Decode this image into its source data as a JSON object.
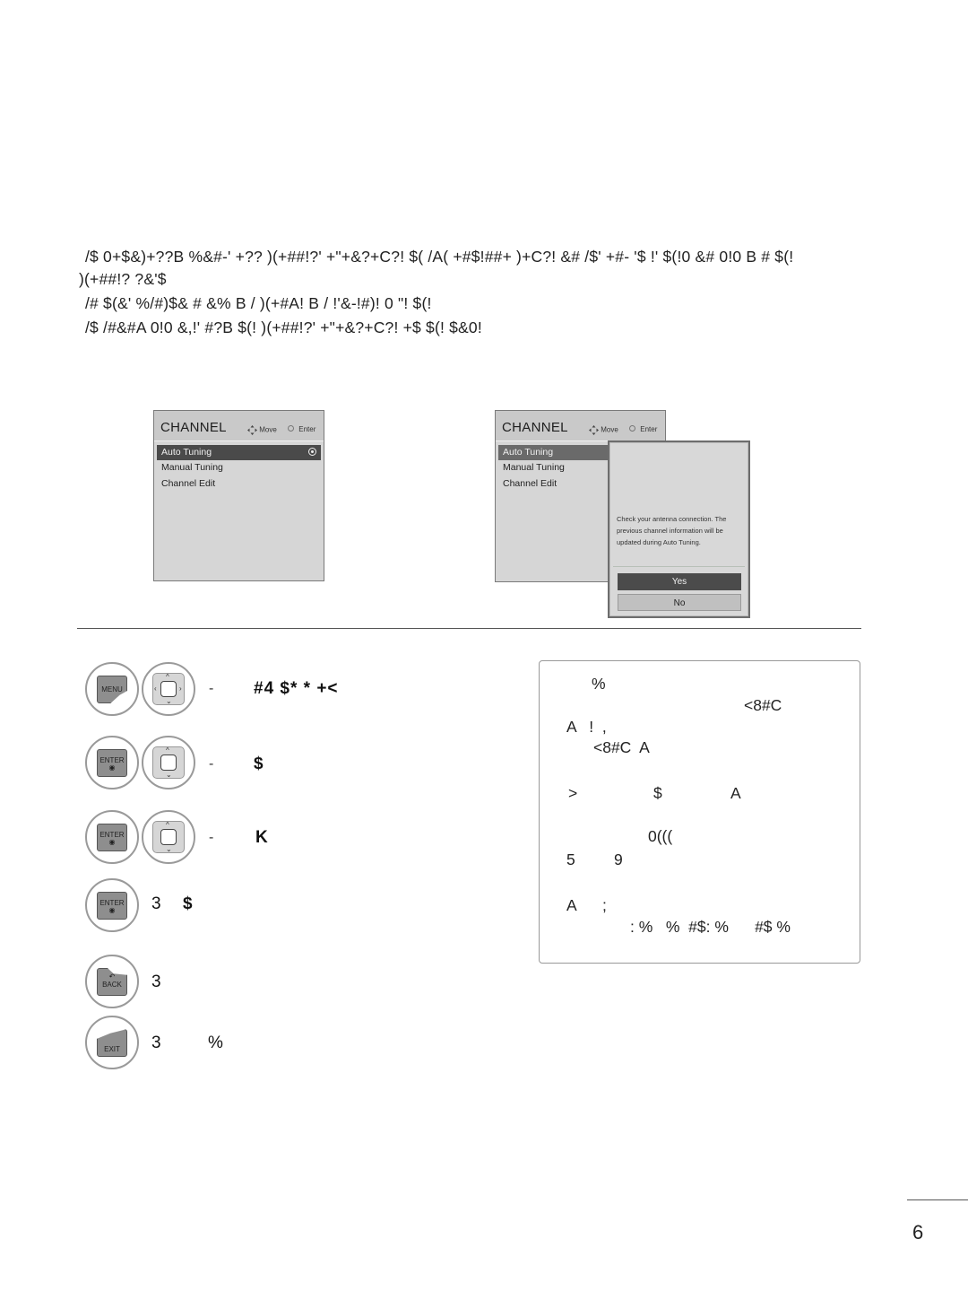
{
  "intro": {
    "lines": [
      "/$ 0+$&)+??B %&#-' +?? )(+##!?' +\"+&?+C?! $(  /A( +#$!##+     )+C?! &# /$'  +#- '$  !' $(!0 &# 0!0  B  # $(!",
      ")(+##!? ?&'$",
      "/# $(&' %/#)$& # &% B / )(+#A! B /   !'&-!#)!    0 \"! $(!",
      "/$   /#&#A 0!0  &,!'  #?B $(! )(+##!?' +\"+&?+C?! +$ $(! $&0!"
    ]
  },
  "osd_left": {
    "title": "CHANNEL",
    "hint_move": "Move",
    "hint_enter": "Enter",
    "items": [
      "Auto Tuning",
      "Manual Tuning",
      "Channel Edit"
    ],
    "selected_index": 0
  },
  "osd_right": {
    "title": "CHANNEL",
    "hint_move": "Move",
    "hint_enter": "Enter",
    "items": [
      "Auto Tuning",
      "Manual Tuning",
      "Channel Edit"
    ],
    "popup": {
      "message": "Check your antenna connection. The previous channel information will be updated during Auto Tuning.",
      "yes_label": "Yes",
      "no_label": "No"
    }
  },
  "steps": [
    {
      "keys": [
        "MENU",
        "nav-4way"
      ],
      "marker": "-",
      "text": "#4 $* * +<"
    },
    {
      "keys": [
        "ENTER",
        "nav-updown"
      ],
      "marker": "-",
      "text": "$"
    },
    {
      "keys": [
        "ENTER",
        "nav-updown"
      ],
      "marker": "-",
      "text": "K"
    },
    {
      "keys": [
        "ENTER"
      ],
      "marker": "3",
      "text": "$"
    },
    {
      "keys": [
        "BACK"
      ],
      "marker": "3",
      "text": ""
    },
    {
      "keys": [
        "EXIT"
      ],
      "marker": "3",
      "text": "%"
    }
  ],
  "key_labels": {
    "menu": "MENU",
    "enter": "ENTER",
    "back": "BACK",
    "exit": "EXIT"
  },
  "note": {
    "lines": [
      "%",
      "<8#C",
      "A   !  ,",
      "<8#C  A",
      ">",
      "$",
      "A",
      "0(((",
      "5",
      "9",
      "A",
      ";",
      ": %   %  #$: %      #$ %"
    ]
  },
  "page_number": "6"
}
